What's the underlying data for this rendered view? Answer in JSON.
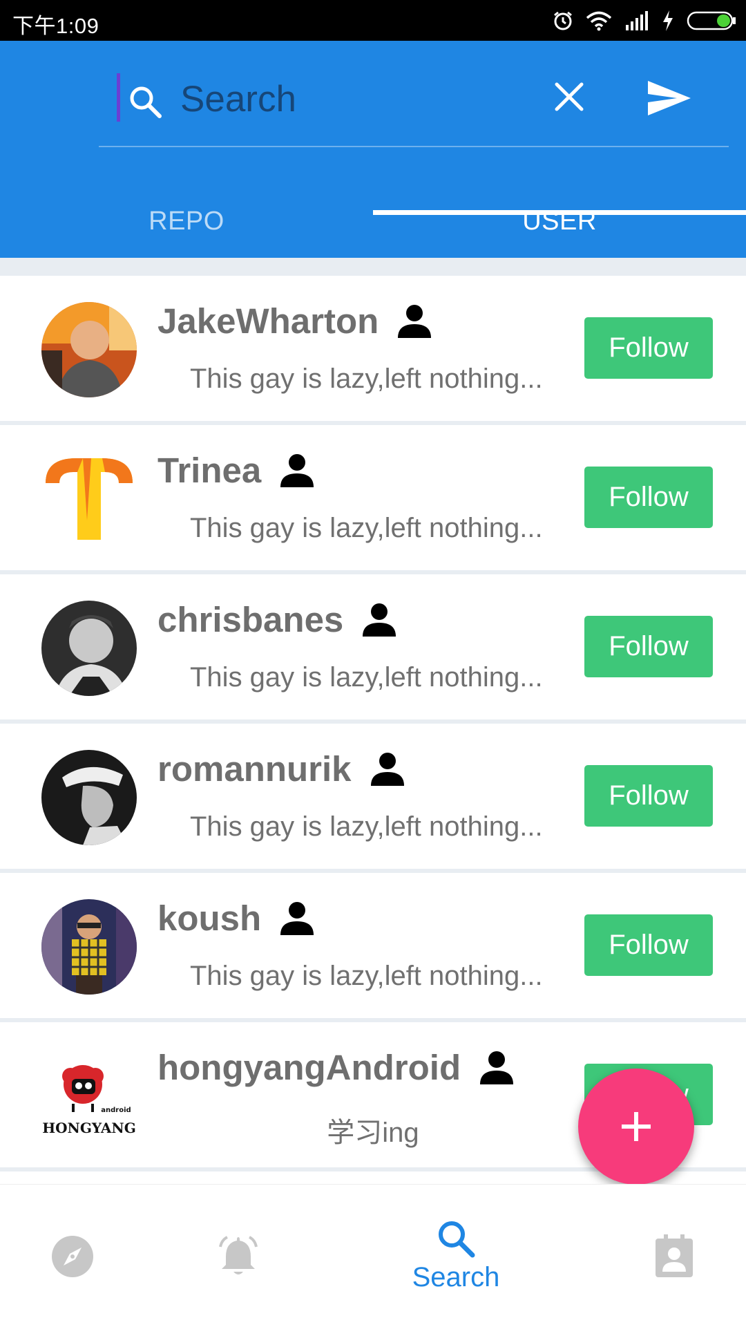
{
  "status_bar": {
    "time": "下午1:09"
  },
  "search": {
    "placeholder": "Search",
    "value": ""
  },
  "tabs": [
    {
      "label": "REPO",
      "active": false
    },
    {
      "label": "USER",
      "active": true
    }
  ],
  "users": [
    {
      "name": "JakeWharton",
      "bio": "This gay is lazy,left nothing...",
      "button": "Follow",
      "avatar": "photo-avatar"
    },
    {
      "name": "Trinea",
      "bio": "This gay is lazy,left nothing...",
      "button": "Follow",
      "avatar": "logo-t-avatar"
    },
    {
      "name": "chrisbanes",
      "bio": "This gay is lazy,left nothing...",
      "button": "Follow",
      "avatar": "photo-avatar"
    },
    {
      "name": "romannurik",
      "bio": "This gay is lazy,left nothing...",
      "button": "Follow",
      "avatar": "photo-avatar"
    },
    {
      "name": "koush",
      "bio": "This gay is lazy,left nothing...",
      "button": "Follow",
      "avatar": "photo-avatar"
    },
    {
      "name": "hongyangAndroid",
      "bio": "学习ing",
      "button": "Follow",
      "avatar": "logo-hongyang-avatar",
      "logo_text": "HONGYANG",
      "logo_small_text": "android"
    }
  ],
  "fab": {
    "icon": "plus-icon"
  },
  "bottom_nav": [
    {
      "icon": "compass-icon",
      "label": "",
      "active": false
    },
    {
      "icon": "bell-icon",
      "label": "",
      "active": false
    },
    {
      "icon": "search-icon",
      "label": "Search",
      "active": true
    },
    {
      "icon": "contact-icon",
      "label": "",
      "active": false
    }
  ],
  "colors": {
    "primary": "#1f86e3",
    "follow": "#3ec779",
    "fab": "#f73b7b",
    "nav_active": "#1f86e3",
    "nav_inactive": "#c7c7c7"
  }
}
